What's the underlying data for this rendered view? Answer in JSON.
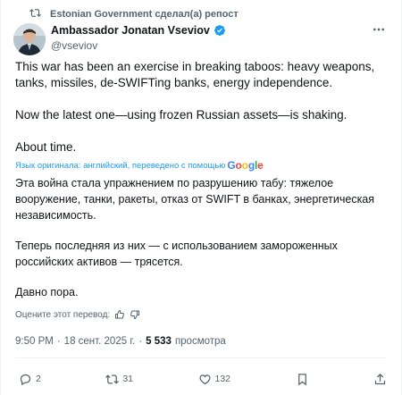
{
  "repost": {
    "label": "Estonian Government сделал(а) репост"
  },
  "author": {
    "name": "Ambassador Jonatan Vseviov",
    "handle": "@vseviov"
  },
  "tweet": {
    "original": [
      "This war has been an exercise in breaking taboos: heavy weapons, tanks, missiles, de-SWIFTing banks, energy independence.",
      "Now the latest one—using frozen Russian assets—is shaking.",
      "About time."
    ],
    "translation_note": "Язык оригинала: английский, переведено с помощью",
    "translation_provider": "Google",
    "translated": [
      "Эта война стала упражнением по разрушению табу: тяжелое вооружение, танки, ракеты, отказ от SWIFT в банках, энергетическая независимость.",
      "Теперь последняя из них — с использованием замороженных российских активов — трясется.",
      "Давно пора."
    ],
    "rate_translation": "Оцените этот перевод:",
    "time": "9:50 PM",
    "date": "18 сент. 2025 г.",
    "views_count": "5 533",
    "views_label": "просмотра"
  },
  "actions": {
    "replies": "2",
    "reposts": "31",
    "likes": "132"
  },
  "colors": {
    "accent": "#1d9bf0",
    "secondary_text": "#536471",
    "primary_text": "#0f1419"
  }
}
